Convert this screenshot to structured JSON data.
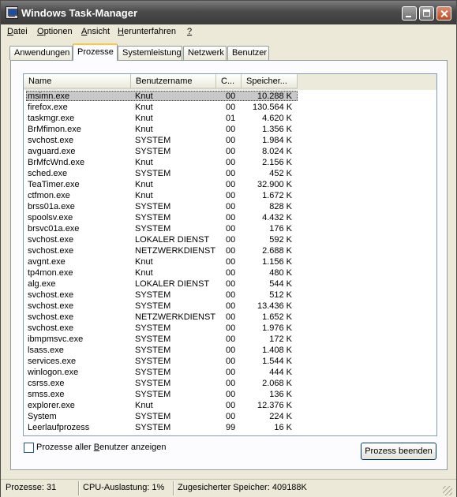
{
  "window": {
    "title": "Windows Task-Manager"
  },
  "menu": [
    {
      "label": "Datei",
      "underline": "D",
      "rest": "atei"
    },
    {
      "label": "Optionen",
      "underline": "O",
      "rest": "ptionen"
    },
    {
      "label": "Ansicht",
      "underline": "A",
      "rest": "nsicht"
    },
    {
      "label": "Herunterfahren",
      "underline": "H",
      "rest": "erunterfahren"
    },
    {
      "label": "?",
      "underline": "?",
      "rest": ""
    }
  ],
  "tabs": [
    {
      "label": "Anwendungen",
      "active": false
    },
    {
      "label": "Prozesse",
      "active": true
    },
    {
      "label": "Systemleistung",
      "active": false
    },
    {
      "label": "Netzwerk",
      "active": false
    },
    {
      "label": "Benutzer",
      "active": false
    }
  ],
  "columns": {
    "name": "Name",
    "user": "Benutzername",
    "cpu": "C...",
    "mem": "Speicher..."
  },
  "processes": [
    {
      "name": "msimn.exe",
      "user": "Knut",
      "cpu": "00",
      "mem": "10.288 K",
      "selected": true
    },
    {
      "name": "firefox.exe",
      "user": "Knut",
      "cpu": "00",
      "mem": "130.564 K"
    },
    {
      "name": "taskmgr.exe",
      "user": "Knut",
      "cpu": "01",
      "mem": "4.620 K"
    },
    {
      "name": "BrMfimon.exe",
      "user": "Knut",
      "cpu": "00",
      "mem": "1.356 K"
    },
    {
      "name": "svchost.exe",
      "user": "SYSTEM",
      "cpu": "00",
      "mem": "1.984 K"
    },
    {
      "name": "avguard.exe",
      "user": "SYSTEM",
      "cpu": "00",
      "mem": "8.024 K"
    },
    {
      "name": "BrMfcWnd.exe",
      "user": "Knut",
      "cpu": "00",
      "mem": "2.156 K"
    },
    {
      "name": "sched.exe",
      "user": "SYSTEM",
      "cpu": "00",
      "mem": "452 K"
    },
    {
      "name": "TeaTimer.exe",
      "user": "Knut",
      "cpu": "00",
      "mem": "32.900 K"
    },
    {
      "name": "ctfmon.exe",
      "user": "Knut",
      "cpu": "00",
      "mem": "1.672 K"
    },
    {
      "name": "brss01a.exe",
      "user": "SYSTEM",
      "cpu": "00",
      "mem": "828 K"
    },
    {
      "name": "spoolsv.exe",
      "user": "SYSTEM",
      "cpu": "00",
      "mem": "4.432 K"
    },
    {
      "name": "brsvc01a.exe",
      "user": "SYSTEM",
      "cpu": "00",
      "mem": "176 K"
    },
    {
      "name": "svchost.exe",
      "user": "LOKALER DIENST",
      "cpu": "00",
      "mem": "592 K"
    },
    {
      "name": "svchost.exe",
      "user": "NETZWERKDIENST",
      "cpu": "00",
      "mem": "2.688 K"
    },
    {
      "name": "avgnt.exe",
      "user": "Knut",
      "cpu": "00",
      "mem": "1.156 K"
    },
    {
      "name": "tp4mon.exe",
      "user": "Knut",
      "cpu": "00",
      "mem": "480 K"
    },
    {
      "name": "alg.exe",
      "user": "LOKALER DIENST",
      "cpu": "00",
      "mem": "544 K"
    },
    {
      "name": "svchost.exe",
      "user": "SYSTEM",
      "cpu": "00",
      "mem": "512 K"
    },
    {
      "name": "svchost.exe",
      "user": "SYSTEM",
      "cpu": "00",
      "mem": "13.436 K"
    },
    {
      "name": "svchost.exe",
      "user": "NETZWERKDIENST",
      "cpu": "00",
      "mem": "1.652 K"
    },
    {
      "name": "svchost.exe",
      "user": "SYSTEM",
      "cpu": "00",
      "mem": "1.976 K"
    },
    {
      "name": "ibmpmsvc.exe",
      "user": "SYSTEM",
      "cpu": "00",
      "mem": "172 K"
    },
    {
      "name": "lsass.exe",
      "user": "SYSTEM",
      "cpu": "00",
      "mem": "1.408 K"
    },
    {
      "name": "services.exe",
      "user": "SYSTEM",
      "cpu": "00",
      "mem": "1.544 K"
    },
    {
      "name": "winlogon.exe",
      "user": "SYSTEM",
      "cpu": "00",
      "mem": "444 K"
    },
    {
      "name": "csrss.exe",
      "user": "SYSTEM",
      "cpu": "00",
      "mem": "2.068 K"
    },
    {
      "name": "smss.exe",
      "user": "SYSTEM",
      "cpu": "00",
      "mem": "136 K"
    },
    {
      "name": "explorer.exe",
      "user": "Knut",
      "cpu": "00",
      "mem": "12.376 K"
    },
    {
      "name": "System",
      "user": "SYSTEM",
      "cpu": "00",
      "mem": "224 K"
    },
    {
      "name": "Leerlaufprozess",
      "user": "SYSTEM",
      "cpu": "99",
      "mem": "16 K"
    }
  ],
  "show_all_users": {
    "checked": false,
    "label_pre": "Prozesse aller ",
    "label_u": "B",
    "label_post": "enutzer anzeigen"
  },
  "end_process_button": "Prozess beenden",
  "status": {
    "processes": "Prozesse: 31",
    "cpu": "CPU-Auslastung: 1%",
    "commit": "Zugesicherter Speicher: 409188K"
  }
}
